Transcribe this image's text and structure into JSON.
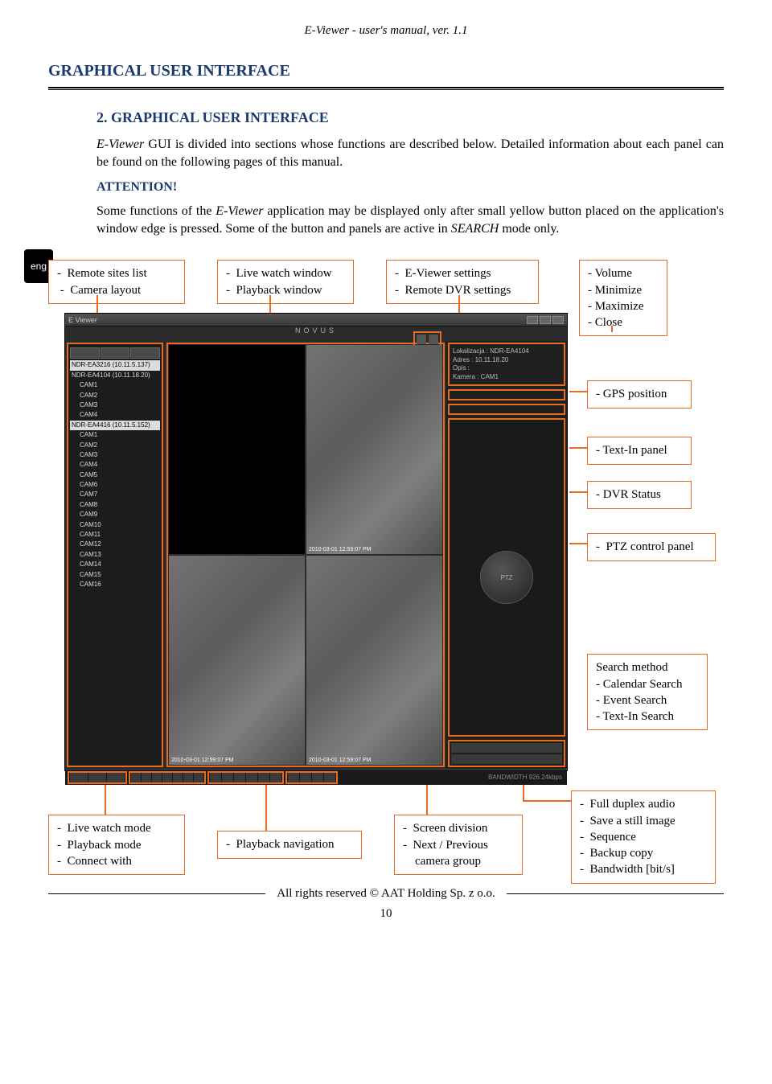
{
  "header": "E-Viewer - user's manual, ver. 1.1",
  "section_title": "GRAPHICAL USER INTERFACE",
  "lang_tab": "eng",
  "num_title": "2.      GRAPHICAL USER INTERFACE",
  "para1_a": "E-Viewer",
  "para1_b": " GUI is divided into sections whose functions are described below. Detailed information about each panel can be found on the following pages of this manual.",
  "attention": "ATTENTION!",
  "para2_a": "Some functions of the ",
  "para2_b": "E-Viewer",
  "para2_c": " application may be displayed only after small yellow button placed on the application's window edge is pressed. Some of the button and panels are active in ",
  "para2_d": "SEARCH",
  "para2_e": "  mode only.",
  "callouts": {
    "top1": "-  Remote sites list\n -  Camera layout",
    "top2": "-  Live watch window\n-  Playback window",
    "top3": "-  E-Viewer settings\n-  Remote DVR settings",
    "top4": "- Volume\n- Minimize\n- Maximize\n- Close",
    "r1": "- GPS position",
    "r2": "- Text-In panel",
    "r3": "- DVR Status",
    "r4": "-  PTZ control panel",
    "r5": "Search method\n- Calendar Search\n- Event Search\n- Text-In Search",
    "b1": "-  Live watch mode\n-  Playback mode\n-  Connect with",
    "b2": "-  Playback navigation",
    "b3": "-  Screen division\n-  Next / Previous\n    camera group",
    "b4": "-  Full duplex audio\n-  Save a still image\n-  Sequence\n-  Backup copy\n-  Bandwidth [bit/s]"
  },
  "screenshot": {
    "title": "E Viewer",
    "logo": "NOVUS",
    "tree": {
      "n0": "NDR-EA3216 (10.11.5.137)",
      "n1": "NDR-EA4104 (10.11.18.20)",
      "c1": "CAM1",
      "c2": "CAM2",
      "c3": "CAM3",
      "c4": "CAM4",
      "n2": "NDR-EA4416 (10.11.5.152)",
      "cc1": "CAM1",
      "cc2": "CAM2",
      "cc3": "CAM3",
      "cc4": "CAM4",
      "cc5": "CAM5",
      "cc6": "CAM6",
      "cc7": "CAM7",
      "cc8": "CAM8",
      "cc9": "CAM9",
      "cc10": "CAM10",
      "cc11": "CAM11",
      "cc12": "CAM12",
      "cc13": "CAM13",
      "cc14": "CAM14",
      "cc15": "CAM15",
      "cc16": "CAM16"
    },
    "info_l1": "Lokalizacja : NDR-EA4104",
    "info_l2": "Adres : 10.11.18.20",
    "info_l3": "Opis :",
    "info_l4": "Kamera : CAM1",
    "ptz": "PTZ",
    "ts": "2010-03-01 12:59:07 PM",
    "status": "BANDWIDTH 926.24kbps"
  },
  "footer": "All rights reserved © AAT Holding Sp. z o.o.",
  "page_num": "10"
}
